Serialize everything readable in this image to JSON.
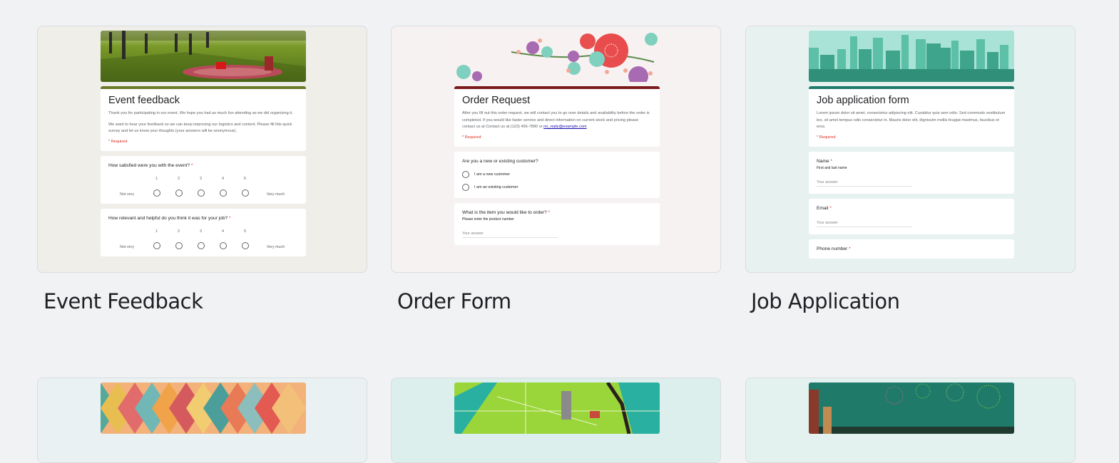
{
  "templates": [
    {
      "name": "Event Feedback",
      "theme_color": "#6a7a26",
      "banner": "picnic-in-park",
      "form": {
        "title": "Event feedback",
        "description": [
          "Thank you for participating in our event. We hope you had as much fun attending as we did organizing it.",
          "We want to hear your feedback so we can keep improving our logistics and content. Please fill this quick survey and let us know your thoughts (your answers will be anonymous)."
        ],
        "required_note": "* Required",
        "questions": [
          {
            "text": "How satisfied were you with the event?",
            "required": "*",
            "scale": [
              "1",
              "2",
              "3",
              "4",
              "5"
            ],
            "low": "Not very",
            "high": "Very much"
          },
          {
            "text": "How relevant and helpful do you think it was for your job?",
            "required": "*",
            "scale": [
              "1",
              "2",
              "3",
              "4",
              "5"
            ],
            "low": "Not very",
            "high": "Very much"
          }
        ]
      }
    },
    {
      "name": "Order Form",
      "theme_color": "#7b1a1a",
      "banner": "floral-branch",
      "form": {
        "title": "Order Request",
        "description": "After you fill out this order request, we will contact you to go over details and availability before the order is completed. If you would like faster service and direct information on current stock and pricing please contact us at Contact us at (123) 456-7890 or",
        "email": "no_reply@example.com",
        "required_note": "* Required",
        "questions": [
          {
            "text": "Are you a new or existing customer?",
            "options": [
              "I am a new customer",
              "I am an existing customer"
            ]
          },
          {
            "text": "What is the item you would like to order?",
            "required": "*",
            "hint": "Please enter the product number",
            "placeholder": "Your answer"
          }
        ]
      }
    },
    {
      "name": "Job Application",
      "theme_color": "#1e7a6a",
      "banner": "city-skyline",
      "form": {
        "title": "Job application form",
        "description": "Lorem ipsum dolor sit amet, consectetur adipiscing elit. Curabitur quis sem odio. Sed commodo vestibulum leo, sit amet tempus odio consectetur in. Mauris dolor elit, dignissim mollis feugiat maximus, faucibus et eros.",
        "required_note": "* Required",
        "questions": [
          {
            "text": "Name",
            "required": "*",
            "hint": "First and last name",
            "placeholder": "Your answer"
          },
          {
            "text": "Email",
            "required": "*",
            "placeholder": "Your answer"
          },
          {
            "text": "Phone number",
            "required": "*"
          }
        ]
      }
    }
  ],
  "second_row_banners": [
    "colorful-diamond-pattern",
    "city-map-illustration",
    "fireworks-night"
  ]
}
